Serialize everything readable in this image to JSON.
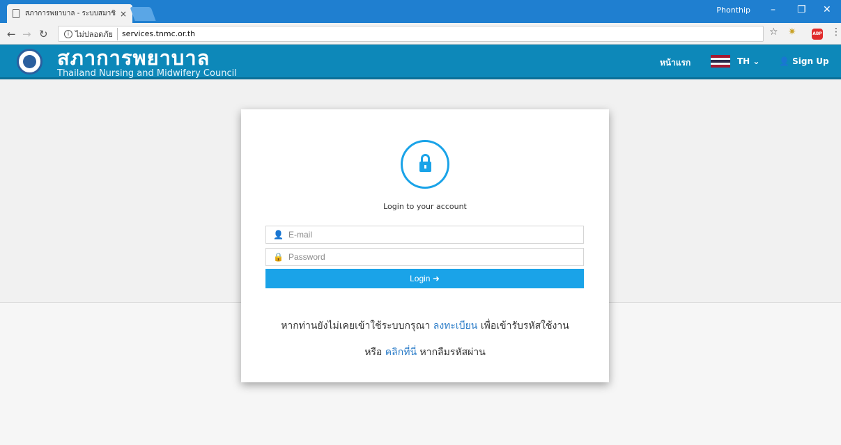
{
  "browser": {
    "tab_title": "สภาการพยาบาล - ระบบสมาชิก",
    "tab_close": "×",
    "profile_name": "Phonthip",
    "security_label": "ไม่ปลอดภัย",
    "url": "services.tnmc.or.th",
    "abp_label": "ABP"
  },
  "header": {
    "brand_th": "สภาการพยาบาล",
    "brand_en": "Thailand Nursing and Midwifery Council",
    "home_label": "หน้าแรก",
    "lang_label": "TH",
    "signup_label": "Sign Up"
  },
  "login": {
    "heading": "Login to your account",
    "email_placeholder": "E-mail",
    "password_placeholder": "Password",
    "button_label": "Login"
  },
  "footer_text": {
    "register_prefix": "หากท่านยังไม่เคยเข้าใช้ระบบกรุณา",
    "register_link": "ลงทะเบียน",
    "register_suffix": "เพื่อเข้ารับรหัสใช้งาน",
    "forgot_prefix": "หรือ",
    "forgot_link": "คลิกที่นี่",
    "forgot_suffix": "หากลืมรหัสผ่าน"
  },
  "colors": {
    "titlebar": "#1f7fd0",
    "header": "#0d88b9",
    "accent": "#1aa3e8",
    "link": "#2b7cc8"
  },
  "icons": [
    "page-icon",
    "back-icon",
    "forward-icon",
    "reload-icon",
    "info-icon",
    "star-icon",
    "extension-icon",
    "menu-icon",
    "user-icon",
    "lock-icon",
    "arrow-right-icon",
    "add-user-icon",
    "thai-flag-icon"
  ]
}
